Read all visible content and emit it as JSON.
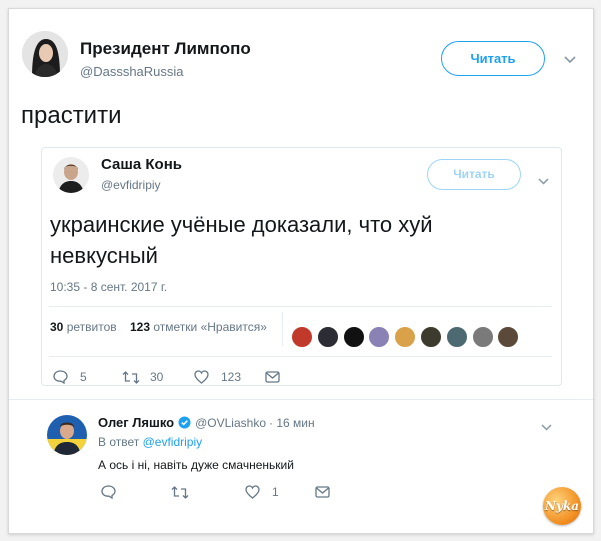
{
  "main_tweet": {
    "author_name": "Президент Лимпопо",
    "author_handle": "@DassshaRussia",
    "follow_label": "Читать",
    "text": "прастити"
  },
  "quoted_tweet": {
    "author_name": "Саша Конь",
    "author_handle": "@evfidripiy",
    "follow_label": "Читать",
    "text_line1": "украинские учёные доказали, что хуй",
    "text_line2": "невкусный",
    "timestamp": "10:35 - 8 сент. 2017 г.",
    "stats": {
      "retweets_count": "30",
      "retweets_label": "ретвитов",
      "likes_count": "123",
      "likes_label": "отметки «Нравится»"
    },
    "likers": [
      {
        "icon": "liker-avatar",
        "color": "#c0392b"
      },
      {
        "icon": "liker-avatar",
        "color": "#2c2c34"
      },
      {
        "icon": "liker-avatar",
        "color": "#111111"
      },
      {
        "icon": "liker-avatar",
        "color": "#8a82b4"
      },
      {
        "icon": "liker-avatar",
        "color": "#d9a24a"
      },
      {
        "icon": "liker-avatar",
        "color": "#3d3a2e"
      },
      {
        "icon": "liker-avatar",
        "color": "#4d6a73"
      },
      {
        "icon": "liker-avatar",
        "color": "#7a7a7a"
      },
      {
        "icon": "liker-avatar",
        "color": "#5b4a3a"
      }
    ],
    "actions": {
      "replies": "5",
      "retweets": "30",
      "likes": "123"
    }
  },
  "reply": {
    "author_name": "Олег Ляшко",
    "verified": true,
    "author_handle": "@OVLiashko",
    "time": "· 16 мин",
    "reply_to_prefix": "В ответ",
    "reply_to_handle": "@evfidripiy",
    "text": "А ось і ні, навіть дуже смачненький",
    "actions": {
      "likes": "1"
    }
  },
  "watermark": {
    "text": "Nyka"
  },
  "colors": {
    "accent": "#1da1f2",
    "muted": "#657786",
    "border": "#e1e8ed"
  }
}
